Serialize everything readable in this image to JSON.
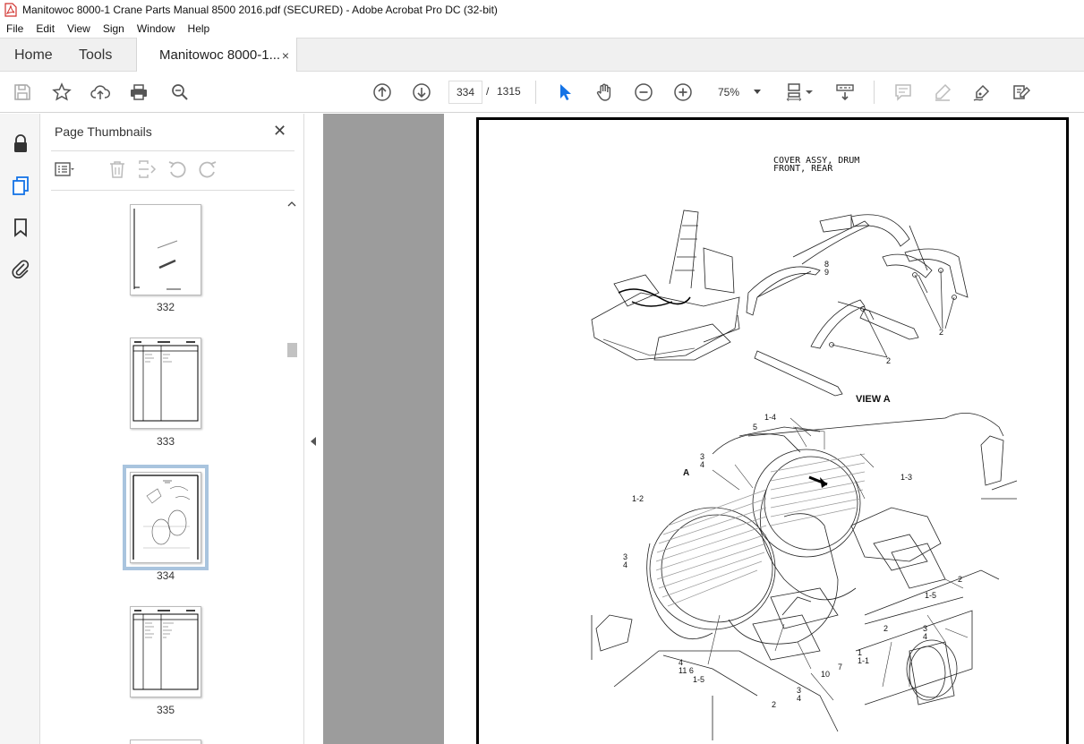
{
  "window": {
    "title": "Manitowoc 8000-1 Crane Parts Manual 8500 2016.pdf (SECURED) - Adobe Acrobat Pro DC (32-bit)"
  },
  "menu": [
    "File",
    "Edit",
    "View",
    "Sign",
    "Window",
    "Help"
  ],
  "tabs": {
    "home": "Home",
    "tools": "Tools",
    "document": "Manitowoc 8000-1...",
    "close": "×"
  },
  "toolbar": {
    "current_page": "334",
    "page_separator": "/",
    "total_pages": "1315",
    "zoom": "75%"
  },
  "panel": {
    "title": "Page Thumbnails",
    "close": "✕",
    "thumbnails": [
      {
        "label": "332"
      },
      {
        "label": "333"
      },
      {
        "label": "334",
        "selected": true
      },
      {
        "label": "335"
      }
    ]
  },
  "document": {
    "heading_line1": "COVER ASSY, DRUM",
    "heading_line2": "FRONT, REAR",
    "view_label": "VIEW A",
    "callouts": {
      "c89": "8\n9",
      "c2a": "2",
      "c2b": "2",
      "c14": "1-4",
      "c5": "5",
      "c34a": "3\n4",
      "cA": "A",
      "c13": "1-3",
      "c12": "1-2",
      "c34b": "3\n4",
      "c15a": "1-5",
      "c2c": "2",
      "c2d": "2",
      "c34c": "3\n4",
      "c1": "1",
      "c11": "1-1",
      "c7": "7",
      "c10": "10",
      "c4116": "4\n11 6",
      "c15b": "1-5",
      "c34d": "3\n4",
      "c2e": "2"
    }
  },
  "colors": {
    "accent": "#1473e6",
    "selected_thumb": "#a9c4de",
    "doc_background": "#9c9c9c"
  }
}
